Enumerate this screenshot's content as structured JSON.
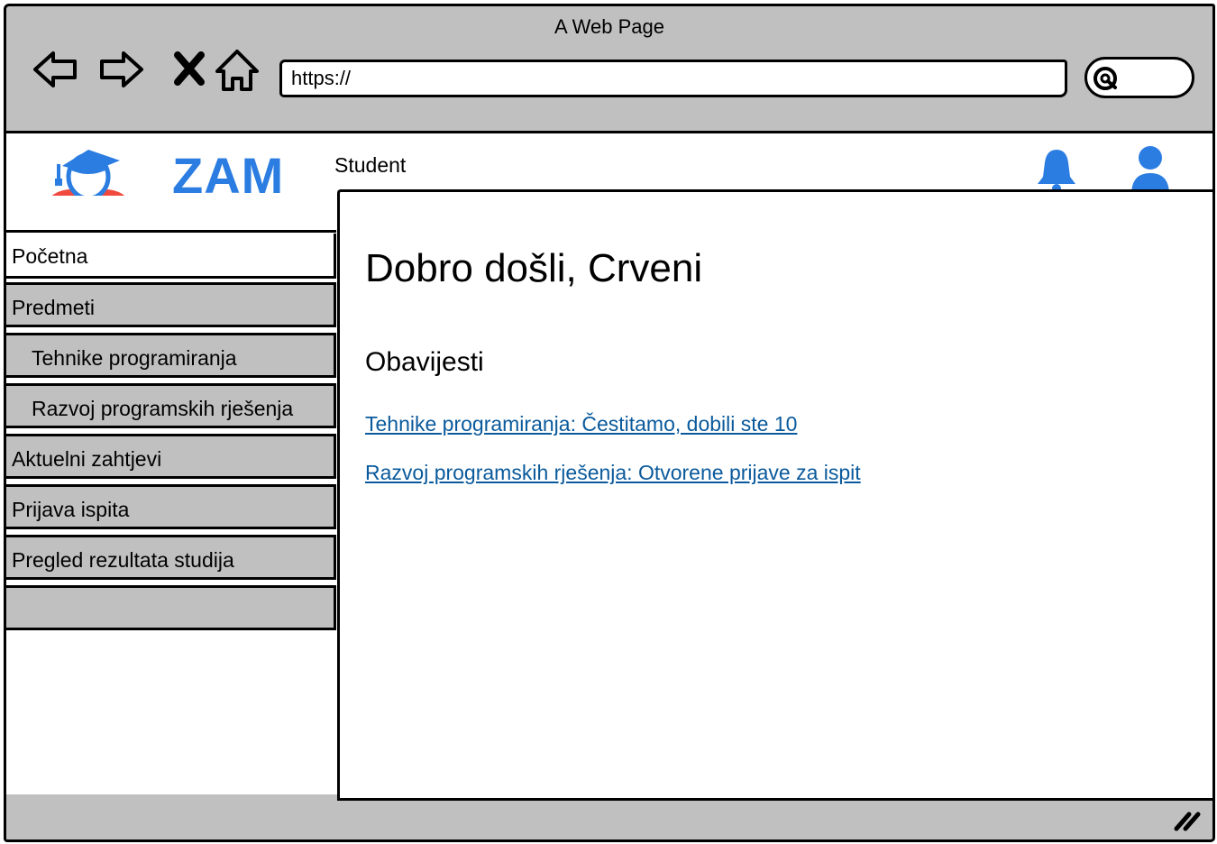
{
  "browser": {
    "window_title": "A Web Page",
    "url_value": "https://",
    "nav_icons": [
      "back-icon",
      "forward-icon",
      "stop-icon",
      "home-icon"
    ],
    "search_icon": "search-icon"
  },
  "header": {
    "brand": "ZAM",
    "role": "Student",
    "colors": {
      "brand": "#2b7de1",
      "avatar_shirt": "#f04a3e",
      "link": "#0a5a9c",
      "chrome_gray": "#c0c0c0"
    },
    "icons": [
      "graduate-logo-icon",
      "bell-icon",
      "user-icon"
    ]
  },
  "sidebar": {
    "items": [
      {
        "label": "Početna",
        "active": true
      },
      {
        "label": "Predmeti"
      },
      {
        "label": "Tehnike programiranja",
        "sub": true
      },
      {
        "label": "Razvoj programskih rješenja",
        "sub": true
      },
      {
        "label": "Aktuelni zahtjevi"
      },
      {
        "label": "Prijava ispita"
      },
      {
        "label": "Pregled rezultata studija"
      },
      {
        "label": ""
      }
    ]
  },
  "main": {
    "title": "Dobro došli, Crveni",
    "notices_heading": "Obavijesti",
    "notices": [
      "Tehnike programiranja: Čestitamo, dobili ste 10",
      "Razvoj programskih rješenja: Otvorene prijave za ispit"
    ]
  }
}
